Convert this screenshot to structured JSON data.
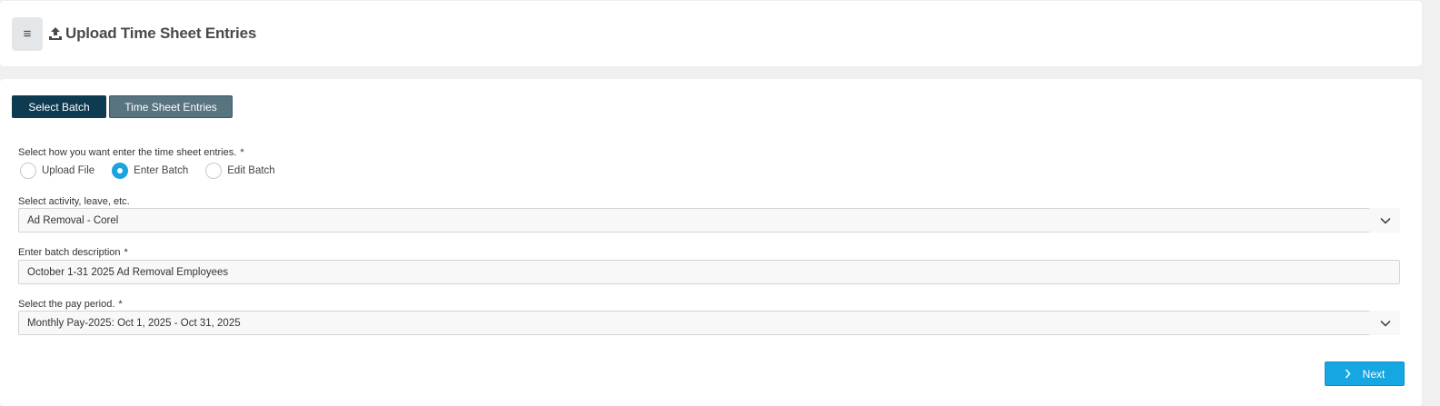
{
  "header": {
    "title": "Upload Time Sheet Entries",
    "menu_icon": "hamburger-icon",
    "title_icon": "upload-icon"
  },
  "tabs": [
    {
      "label": "Select Batch",
      "active": true
    },
    {
      "label": "Time Sheet Entries",
      "active": false
    }
  ],
  "entry_method": {
    "label": "Select how you want enter the time sheet entries.",
    "required_mark": "*",
    "options": [
      {
        "label": "Upload File",
        "checked": false
      },
      {
        "label": "Enter Batch",
        "checked": true
      },
      {
        "label": "Edit Batch",
        "checked": false
      }
    ]
  },
  "activity": {
    "label": "Select activity, leave, etc.",
    "value": "Ad Removal - Corel"
  },
  "description": {
    "label": "Enter batch description",
    "required_mark": "*",
    "value": "October 1-31 2025 Ad Removal Employees"
  },
  "pay_period": {
    "label": "Select the pay period.",
    "required_mark": "*",
    "value": "Monthly Pay-2025: Oct 1, 2025 - Oct 31, 2025"
  },
  "next_button": {
    "label": "Next"
  },
  "colors": {
    "active_tab": "#0e3b52",
    "inactive_tab": "#577480",
    "accent": "#16a7e3"
  }
}
